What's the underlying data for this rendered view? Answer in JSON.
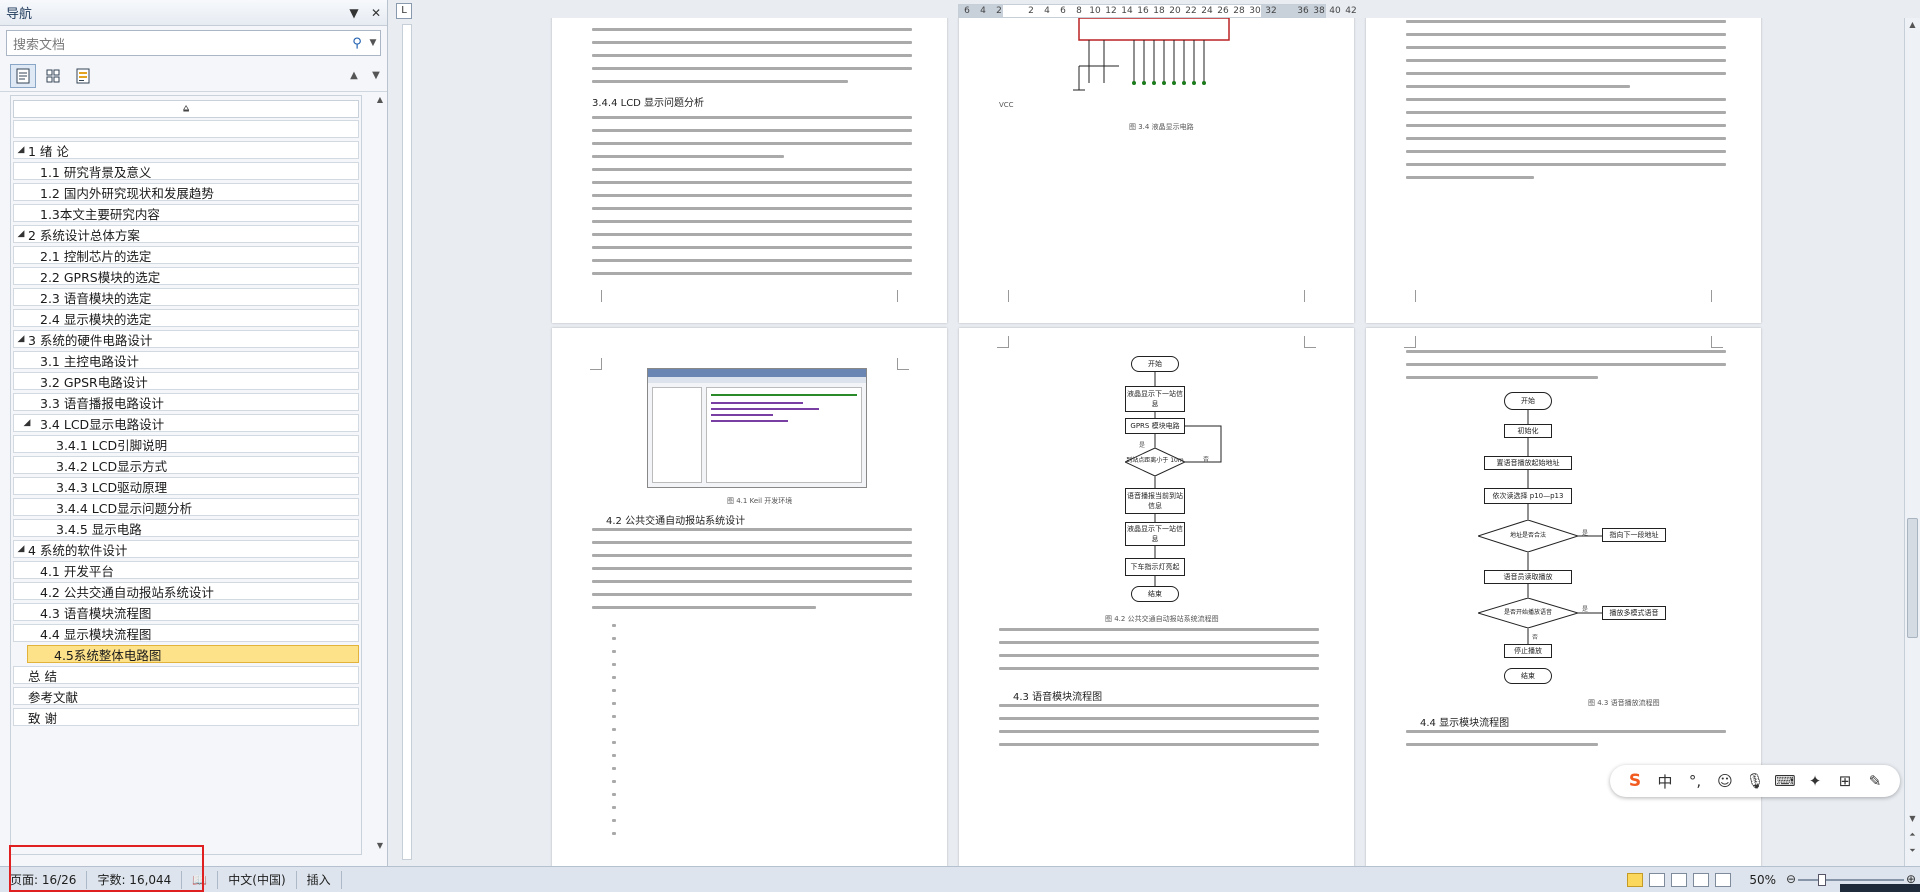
{
  "nav": {
    "title": "导航",
    "search_placeholder": "搜索文档",
    "items": [
      {
        "label": "1 绪 论",
        "level": 0,
        "expanded": true
      },
      {
        "label": "1.1 研究背景及意义",
        "level": 1
      },
      {
        "label": "1.2 国内外研究现状和发展趋势",
        "level": 1
      },
      {
        "label": "1.3本文主要研究内容",
        "level": 1
      },
      {
        "label": "2 系统设计总体方案",
        "level": 0,
        "expanded": true
      },
      {
        "label": "2.1 控制芯片的选定",
        "level": 1
      },
      {
        "label": "2.2 GPRS模块的选定",
        "level": 1
      },
      {
        "label": "2.3 语音模块的选定",
        "level": 1
      },
      {
        "label": "2.4 显示模块的选定",
        "level": 1
      },
      {
        "label": "3 系统的硬件电路设计",
        "level": 0,
        "expanded": true
      },
      {
        "label": "3.1 主控电路设计",
        "level": 1
      },
      {
        "label": "3.2 GPSR电路设计",
        "level": 1
      },
      {
        "label": "3.3 语音播报电路设计",
        "level": 1
      },
      {
        "label": "3.4 LCD显示电路设计",
        "level": 1,
        "expanded": true
      },
      {
        "label": "3.4.1 LCD引脚说明",
        "level": 2
      },
      {
        "label": "3.4.2 LCD显示方式",
        "level": 2
      },
      {
        "label": "3.4.3 LCD驱动原理",
        "level": 2
      },
      {
        "label": "3.4.4 LCD显示问题分析",
        "level": 2
      },
      {
        "label": "3.4.5 显示电路",
        "level": 2
      },
      {
        "label": "4 系统的软件设计",
        "level": 0,
        "expanded": true
      },
      {
        "label": "4.1 开发平台",
        "level": 1
      },
      {
        "label": "4.2 公共交通自动报站系统设计",
        "level": 1
      },
      {
        "label": "4.3 语音模块流程图",
        "level": 1
      },
      {
        "label": "4.4 显示模块流程图",
        "level": 1
      },
      {
        "label": "4.5系统整体电路图",
        "level": 1,
        "selected": true
      },
      {
        "label": "总 结",
        "level": 0
      },
      {
        "label": "参考文献",
        "level": 0
      },
      {
        "label": "致 谢",
        "level": 0
      }
    ]
  },
  "ruler": {
    "ticks": [
      "6",
      "4",
      "2",
      "",
      "2",
      "4",
      "6",
      "8",
      "10",
      "12",
      "14",
      "16",
      "18",
      "20",
      "22",
      "24",
      "26",
      "28",
      "30",
      "32",
      "",
      "36",
      "38",
      "40",
      "42"
    ]
  },
  "pages": {
    "p1_heading": "3.4.4 LCD 显示问题分析",
    "p2_caption": "图 3.4 液晶显示电路",
    "p2_vcc": "VCC",
    "p4_caption": "图 4.1 Keil 开发环境",
    "p4_heading": "4.2 公共交通自动报站系统设计",
    "p5_caption": "图 4.2 公共交通自动报站系统流程图",
    "p5_heading": "4.3 语音模块流程图",
    "p5_flow": [
      "开始",
      "液晶显示下一站信息",
      "GPRS 模块电路",
      "到站点距离小于 10m",
      "是",
      "否",
      "语音播报当前到站信息",
      "液晶显示下一站信息",
      "下车指示灯亮起",
      "结束"
    ],
    "p6_heading": "4.4 显示模块流程图",
    "p6_caption": "图 4.3 语音播放流程图",
    "p6_flow": [
      "开始",
      "初始化",
      "置语音播放起始地址",
      "依次读选择 p10—p13",
      "地址是否合法",
      "是",
      "指向下一段地址",
      "语音员读取播放",
      "是否开始播放语音",
      "是",
      "播放多模式语音",
      "否",
      "停止播放",
      "结束"
    ]
  },
  "status": {
    "page": "页面: 16/26",
    "words": "字数: 16,044",
    "lang": "中文(中国)",
    "mode": "插入",
    "zoom": "50%",
    "zoom_level_percent": 50
  },
  "ime": {
    "logo": "S",
    "lang": "中",
    "punct": "°,",
    "items": [
      "emoji-icon",
      "mic-icon",
      "keyboard-icon",
      "skin-icon",
      "grid-icon",
      "tools-icon"
    ]
  },
  "colors": {
    "selected_bg": "#fde28a",
    "highlight_red": "#e02020",
    "ime_orange": "#f25b1f"
  }
}
